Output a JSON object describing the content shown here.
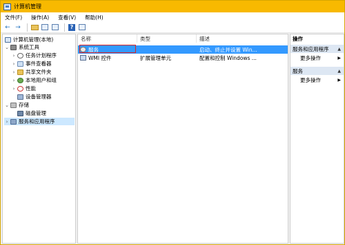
{
  "window": {
    "title": "计算机管理"
  },
  "menu": [
    "文件(F)",
    "操作(A)",
    "查看(V)",
    "帮助(H)"
  ],
  "toolbar": {
    "back_icon": "←",
    "forward_icon": "→",
    "help_label": "?"
  },
  "tree": {
    "root": "计算机管理(本地)",
    "system_tools": "系统工具",
    "task_scheduler": "任务计划程序",
    "event_viewer": "事件查看器",
    "shared_folders": "共享文件夹",
    "local_users": "本地用户和组",
    "performance": "性能",
    "device_manager": "设备管理器",
    "storage": "存储",
    "disk_management": "磁盘管理",
    "services_apps": "服务和应用程序",
    "expanded_glyph": "⌄",
    "collapsed_glyph": "›"
  },
  "list": {
    "columns": [
      "名称",
      "类型",
      "描述"
    ],
    "rows": [
      {
        "name": "服务",
        "type": "",
        "desc": "启动、终止并设置 Win..."
      },
      {
        "name": "WMI 控件",
        "type": "扩展管理单元",
        "desc": "配置和控制 Windows ..."
      }
    ]
  },
  "actions": {
    "title": "操作",
    "section1": "服务和应用程序",
    "more1": "更多操作",
    "section2": "服务",
    "more2": "更多操作",
    "caret": "▲",
    "arrow": "▶"
  },
  "colors": {
    "titlebar": "#f8b900",
    "selection": "#3399ff",
    "highlight_box": "#e02020"
  }
}
